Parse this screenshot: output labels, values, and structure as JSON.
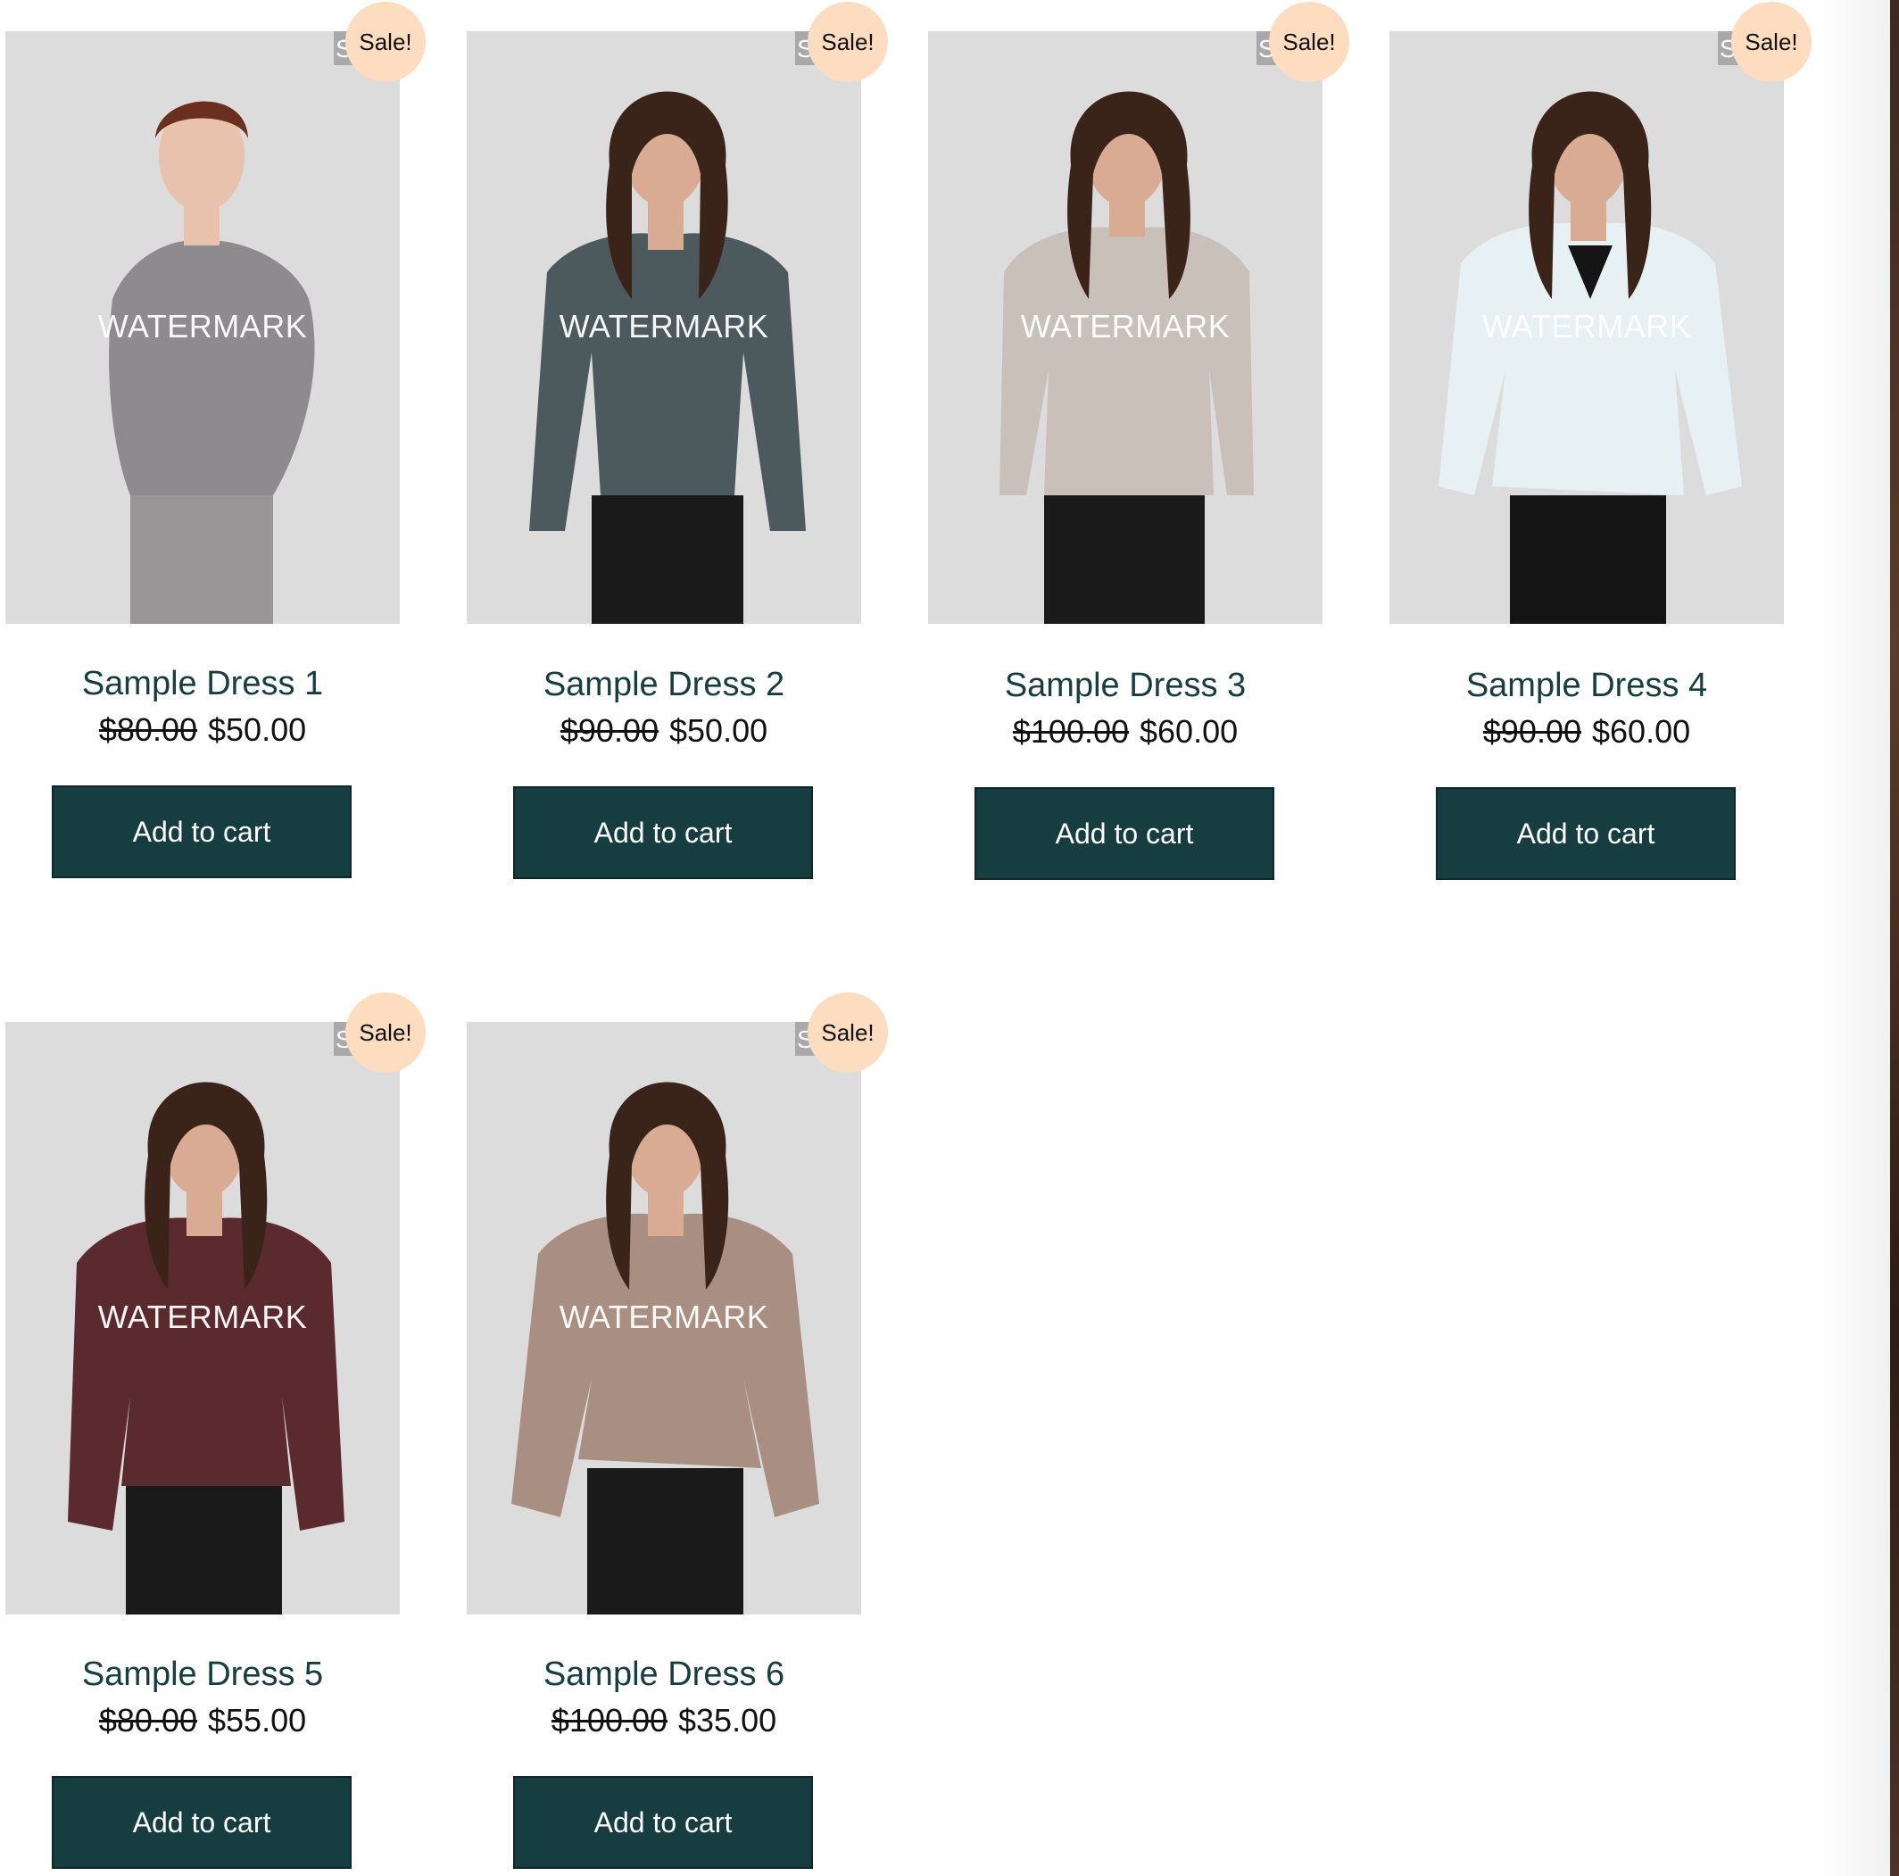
{
  "products": [
    {
      "title": "Sample Dress 1",
      "old_price": "$80.00",
      "price": "$50.00",
      "badge": "Sale!",
      "sku": "SK",
      "watermark": "WATERMARK",
      "button": "Add to cart",
      "top_color": "#8d8b8d",
      "skin_color": "#e8c2ad",
      "hair_color": "#6b2f1f",
      "bottom_color": "#9a9596"
    },
    {
      "title": "Sample Dress 2",
      "old_price": "$90.00",
      "price": "$50.00",
      "badge": "Sale!",
      "sku": "SK",
      "watermark": "WATERMARK",
      "button": "Add to cart",
      "top_color": "#4c5a5e",
      "skin_color": "#d9ab92",
      "hair_color": "#3a2419",
      "bottom_color": "#1a1a1a"
    },
    {
      "title": "Sample Dress 3",
      "old_price": "$100.00",
      "price": "$60.00",
      "badge": "Sale!",
      "sku": "SK",
      "watermark": "WATERMARK",
      "button": "Add to cart",
      "top_color": "#c9c1b9",
      "skin_color": "#d9ab92",
      "hair_color": "#3a2419",
      "bottom_color": "#1a1a1a"
    },
    {
      "title": "Sample Dress 4",
      "old_price": "$90.00",
      "price": "$60.00",
      "badge": "Sale!",
      "sku": "SK",
      "watermark": "WATERMARK",
      "button": "Add to cart",
      "top_color": "#e7f1f4",
      "skin_color": "#d9ab92",
      "hair_color": "#3a2419",
      "bottom_color": "#141414"
    },
    {
      "title": "Sample Dress 5",
      "old_price": "$80.00",
      "price": "$55.00",
      "badge": "Sale!",
      "sku": "SK",
      "watermark": "WATERMARK",
      "button": "Add to cart",
      "top_color": "#5a2a2e",
      "skin_color": "#d9ab92",
      "hair_color": "#3a2419",
      "bottom_color": "#1a1a1a"
    },
    {
      "title": "Sample Dress 6",
      "old_price": "$100.00",
      "price": "$35.00",
      "badge": "Sale!",
      "sku": "SK",
      "watermark": "WATERMARK",
      "button": "Add to cart",
      "top_color": "#a88f82",
      "skin_color": "#d9ab92",
      "hair_color": "#3a2419",
      "bottom_color": "#1a1a1a"
    }
  ]
}
